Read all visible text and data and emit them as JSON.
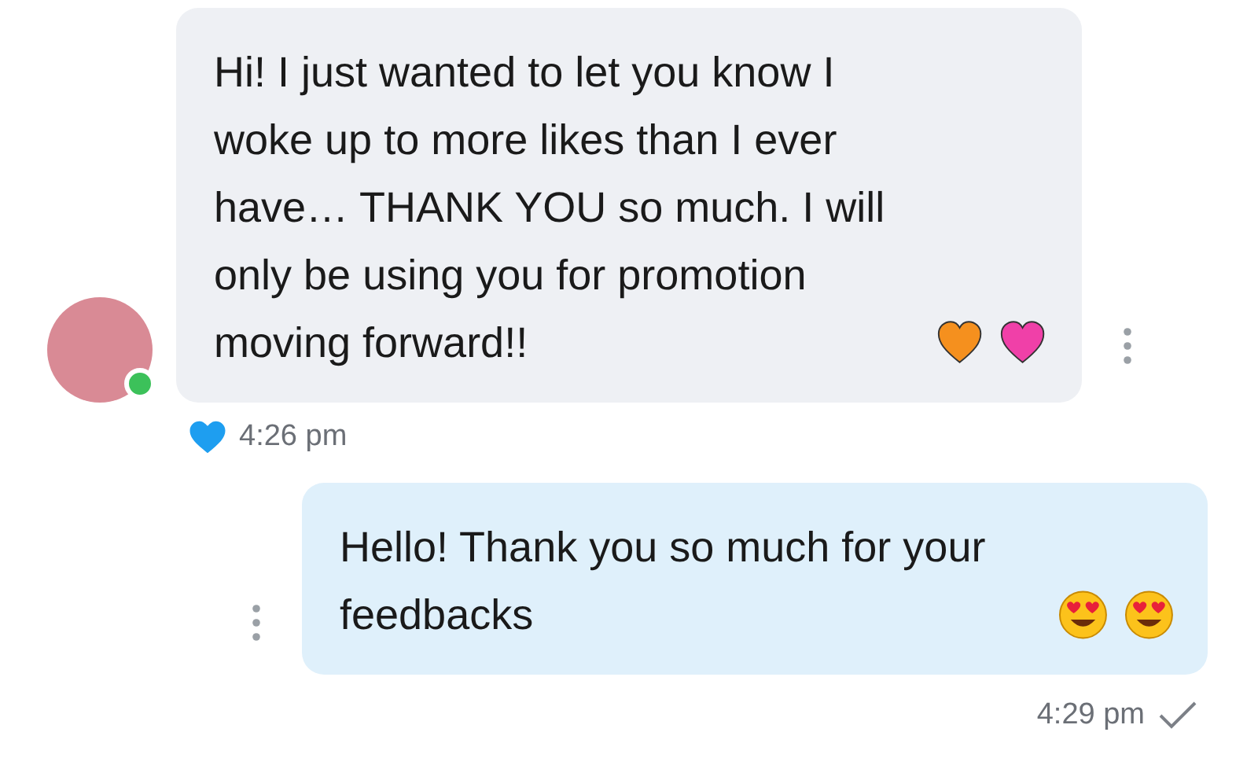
{
  "messages": [
    {
      "kind": "incoming",
      "text": "Hi! I just wanted to let you know I woke up to more likes than I ever have… THANK YOU so much. I will only be using you for promotion moving forward!!",
      "emojis": [
        {
          "kind": "heart",
          "color": "#f5901e"
        },
        {
          "kind": "heart",
          "color": "#f040a8"
        }
      ],
      "online": true,
      "liked": true,
      "time": "4:26 pm"
    },
    {
      "kind": "outgoing",
      "text": "Hello! Thank you so much for your feedbacks",
      "emojis": [
        {
          "kind": "face"
        },
        {
          "kind": "face"
        }
      ],
      "sent": true,
      "time": "4:29 pm"
    }
  ]
}
